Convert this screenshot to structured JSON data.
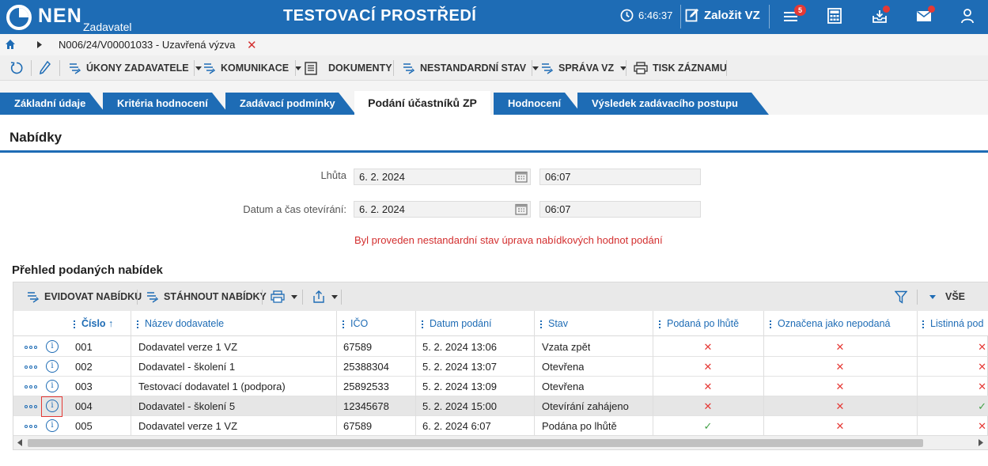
{
  "header": {
    "logo_text": "NEN",
    "logo_sub": "Zadavatel",
    "env_title": "TESTOVACÍ PROSTŘEDÍ",
    "clock": "6:46:37",
    "new_vz": "Založit VZ",
    "menu_badge": "5",
    "colors": {
      "brand": "#1e6cb5",
      "badge": "#e53935"
    },
    "icons": [
      "clock-icon",
      "edit-icon",
      "menu-icon",
      "calculator-icon",
      "inbox-icon",
      "mail-icon",
      "user-icon"
    ]
  },
  "breadcrumb": {
    "text": "N006/24/V00001033 - Uzavřená výzva",
    "close": "✕"
  },
  "toolbar": {
    "ukony": "ÚKONY ZADAVATELE",
    "komunikace": "KOMUNIKACE",
    "dokumenty": "DOKUMENTY",
    "nestandardni": "NESTANDARDNÍ STAV",
    "sprava": "SPRÁVA VZ",
    "tisk": "TISK ZÁZNAMU"
  },
  "tabs": [
    {
      "label": "Základní údaje",
      "active": false
    },
    {
      "label": "Kritéria hodnocení",
      "active": false
    },
    {
      "label": "Zadávací podmínky",
      "active": false
    },
    {
      "label": "Podání účastníků ZP",
      "active": true
    },
    {
      "label": "Hodnocení",
      "active": false
    },
    {
      "label": "Výsledek zadávacího postupu",
      "active": false
    }
  ],
  "section": {
    "title": "Nabídky",
    "lhuta_label": "Lhůta",
    "lhuta_date": "6. 2. 2024",
    "lhuta_time": "06:07",
    "otevirani_label": "Datum a čas otevírání:",
    "otevirani_date": "6. 2. 2024",
    "otevirani_time": "06:07",
    "warning": "Byl proveden nestandardní stav úprava nabídkových hodnot podání"
  },
  "overview": {
    "title": "Přehled podaných nabídek",
    "toolbar": {
      "evidovat": "EVIDOVAT NABÍDKU",
      "stahnout": "STÁHNOUT NABÍDKY",
      "vse": "VŠE"
    },
    "columns": {
      "cislo": "Číslo",
      "sort": "↑",
      "nazev": "Název dodavatele",
      "ico": "IČO",
      "datum": "Datum podání",
      "stav": "Stav",
      "podana": "Podaná po lhůtě",
      "oznacena": "Označena jako nepodaná",
      "listinna": "Listinná pod"
    },
    "rows": [
      {
        "cislo": "001",
        "nazev": "Dodavatel verze 1 VZ",
        "ico": "67589",
        "datum": "5. 2. 2024 13:06",
        "stav": "Vzata zpět",
        "podana": false,
        "oznacena": false,
        "listinna": false,
        "selected": false
      },
      {
        "cislo": "002",
        "nazev": "Dodavatel - školení 1",
        "ico": "25388304",
        "datum": "5. 2. 2024 13:07",
        "stav": "Otevřena",
        "podana": false,
        "oznacena": false,
        "listinna": false,
        "selected": false
      },
      {
        "cislo": "003",
        "nazev": "Testovací dodavatel 1 (podpora)",
        "ico": "25892533",
        "datum": "5. 2. 2024 13:09",
        "stav": "Otevřena",
        "podana": false,
        "oznacena": false,
        "listinna": false,
        "selected": false
      },
      {
        "cislo": "004",
        "nazev": "Dodavatel - školení 5",
        "ico": "12345678",
        "datum": "5. 2. 2024 15:00",
        "stav": "Otevírání zahájeno",
        "podana": false,
        "oznacena": false,
        "listinna": true,
        "selected": true
      },
      {
        "cislo": "005",
        "nazev": "Dodavatel verze 1 VZ",
        "ico": "67589",
        "datum": "6. 2. 2024 6:07",
        "stav": "Podána po lhůtě",
        "podana": true,
        "oznacena": false,
        "listinna": false,
        "selected": false
      }
    ],
    "marks": {
      "yes": "✓",
      "no": "✕"
    },
    "info_glyph": "i"
  }
}
